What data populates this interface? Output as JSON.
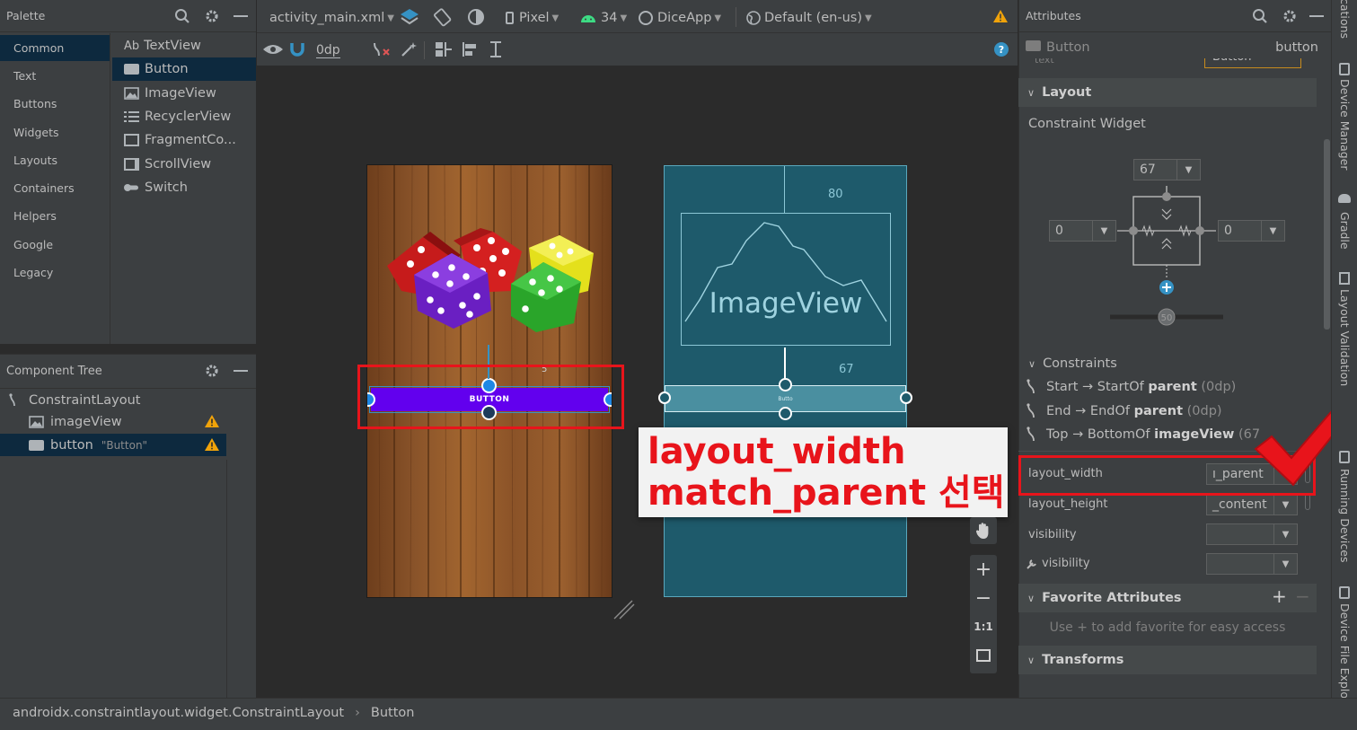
{
  "palette": {
    "title": "Palette",
    "categories": [
      "Common",
      "Text",
      "Buttons",
      "Widgets",
      "Layouts",
      "Containers",
      "Helpers",
      "Google",
      "Legacy"
    ],
    "selected_category": "Common",
    "items": [
      {
        "label": "TextView",
        "icon": "ab-text-icon",
        "prefix": "Ab"
      },
      {
        "label": "Button",
        "icon": "button-icon"
      },
      {
        "label": "ImageView",
        "icon": "image-icon"
      },
      {
        "label": "RecyclerView",
        "icon": "list-icon"
      },
      {
        "label": "FragmentCo...",
        "icon": "fragment-icon"
      },
      {
        "label": "ScrollView",
        "icon": "scroll-icon"
      },
      {
        "label": "Switch",
        "icon": "switch-icon"
      }
    ],
    "selected_item": "Button"
  },
  "component_tree": {
    "title": "Component Tree",
    "root": "ConstraintLayout",
    "children": [
      {
        "label": "imageView",
        "hint": "",
        "warning": true
      },
      {
        "label": "button",
        "hint": "\"Button\"",
        "warning": true
      }
    ]
  },
  "toolbar": {
    "file_tab": "activity_main.xml",
    "device": "Pixel",
    "api_level": "34",
    "app": "DiceApp",
    "locale": "Default (en-us)",
    "margin_value": "0dp"
  },
  "canvas": {
    "button_label": "BUTTON",
    "blueprint_button_label": "Butto",
    "blueprint_image_label": "ImageView",
    "blueprint_top_margin": "80",
    "blueprint_mid_margin": "67",
    "design_mid_margin": "5"
  },
  "callout": {
    "line1": "layout_width",
    "line2": "match_parent 선택",
    "colors": {
      "text": "#e8141b",
      "box": "#e8141b"
    }
  },
  "zoom_controls": {
    "fit_label": "1:1"
  },
  "attributes": {
    "title": "Attributes",
    "component_type": "Button",
    "component_id": "button",
    "hidden_field_label": "text",
    "hidden_field_value": "Button",
    "layout_section": "Layout",
    "constraint_widget": "Constraint Widget",
    "top_margin": "67",
    "start_margin": "0",
    "end_margin": "0",
    "bias": "50",
    "constraints_section": "Constraints",
    "constraints": [
      {
        "prefix": "Start → StartOf ",
        "target": "parent",
        "suffix": " (0dp)"
      },
      {
        "prefix": "End → EndOf ",
        "target": "parent",
        "suffix": " (0dp)"
      },
      {
        "prefix": "Top → BottomOf ",
        "target": "imageView",
        "suffix": " (67"
      }
    ],
    "fields": [
      {
        "label": "layout_width",
        "value": "ı_parent"
      },
      {
        "label": "layout_height",
        "value": "_content"
      },
      {
        "label": "visibility",
        "value": ""
      },
      {
        "label": "visibility",
        "value": ""
      }
    ],
    "favorite_section": "Favorite Attributes",
    "favorite_hint": "Use + to add favorite for easy access",
    "transforms_section": "Transforms"
  },
  "right_tabs": [
    "cations",
    "Device Manager",
    "Gradle",
    "Layout Validation",
    "Running Devices",
    "Device File Explorer"
  ],
  "status_bar": {
    "path": "androidx.constraintlayout.widget.ConstraintLayout",
    "current": "Button"
  },
  "colors": {
    "accent_blue": "#3592c4",
    "button_purple": "#6200ee",
    "blueprint": "#1e5a6b",
    "warning": "#f0a30a",
    "selection": "#0d293e"
  }
}
